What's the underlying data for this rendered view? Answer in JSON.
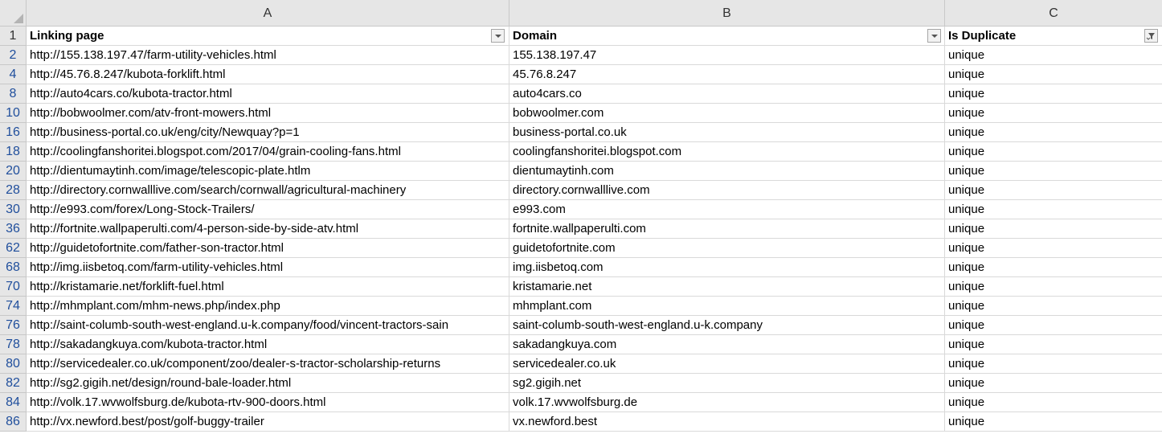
{
  "columns": [
    "A",
    "B",
    "C"
  ],
  "header_row_number": "1",
  "headers": {
    "linking_page": "Linking page",
    "domain": "Domain",
    "is_duplicate": "Is Duplicate"
  },
  "filter_icons": {
    "linking_page": "dropdown-arrow-icon",
    "domain": "dropdown-arrow-icon",
    "is_duplicate": "filter-funnel-icon"
  },
  "rows": [
    {
      "num": "2",
      "linking_page": "http://155.138.197.47/farm-utility-vehicles.html",
      "domain": "155.138.197.47",
      "is_duplicate": "unique"
    },
    {
      "num": "4",
      "linking_page": "http://45.76.8.247/kubota-forklift.html",
      "domain": "45.76.8.247",
      "is_duplicate": "unique"
    },
    {
      "num": "8",
      "linking_page": "http://auto4cars.co/kubota-tractor.html",
      "domain": "auto4cars.co",
      "is_duplicate": "unique"
    },
    {
      "num": "10",
      "linking_page": "http://bobwoolmer.com/atv-front-mowers.html",
      "domain": "bobwoolmer.com",
      "is_duplicate": "unique"
    },
    {
      "num": "16",
      "linking_page": "http://business-portal.co.uk/eng/city/Newquay?p=1",
      "domain": "business-portal.co.uk",
      "is_duplicate": "unique"
    },
    {
      "num": "18",
      "linking_page": "http://coolingfanshoritei.blogspot.com/2017/04/grain-cooling-fans.html",
      "domain": "coolingfanshoritei.blogspot.com",
      "is_duplicate": "unique"
    },
    {
      "num": "20",
      "linking_page": "http://dientumaytinh.com/image/telescopic-plate.htlm",
      "domain": "dientumaytinh.com",
      "is_duplicate": "unique"
    },
    {
      "num": "28",
      "linking_page": "http://directory.cornwalllive.com/search/cornwall/agricultural-machinery",
      "domain": "directory.cornwalllive.com",
      "is_duplicate": "unique"
    },
    {
      "num": "30",
      "linking_page": "http://e993.com/forex/Long-Stock-Trailers/",
      "domain": "e993.com",
      "is_duplicate": "unique"
    },
    {
      "num": "36",
      "linking_page": "http://fortnite.wallpaperulti.com/4-person-side-by-side-atv.html",
      "domain": "fortnite.wallpaperulti.com",
      "is_duplicate": "unique"
    },
    {
      "num": "62",
      "linking_page": "http://guidetofortnite.com/father-son-tractor.html",
      "domain": "guidetofortnite.com",
      "is_duplicate": "unique"
    },
    {
      "num": "68",
      "linking_page": "http://img.iisbetoq.com/farm-utility-vehicles.html",
      "domain": "img.iisbetoq.com",
      "is_duplicate": "unique"
    },
    {
      "num": "70",
      "linking_page": "http://kristamarie.net/forklift-fuel.html",
      "domain": "kristamarie.net",
      "is_duplicate": "unique"
    },
    {
      "num": "74",
      "linking_page": "http://mhmplant.com/mhm-news.php/index.php",
      "domain": "mhmplant.com",
      "is_duplicate": "unique"
    },
    {
      "num": "76",
      "linking_page": "http://saint-columb-south-west-england.u-k.company/food/vincent-tractors-sain",
      "domain": "saint-columb-south-west-england.u-k.company",
      "is_duplicate": "unique"
    },
    {
      "num": "78",
      "linking_page": "http://sakadangkuya.com/kubota-tractor.html",
      "domain": "sakadangkuya.com",
      "is_duplicate": "unique"
    },
    {
      "num": "80",
      "linking_page": "http://servicedealer.co.uk/component/zoo/dealer-s-tractor-scholarship-returns",
      "domain": "servicedealer.co.uk",
      "is_duplicate": "unique"
    },
    {
      "num": "82",
      "linking_page": "http://sg2.gigih.net/design/round-bale-loader.html",
      "domain": "sg2.gigih.net",
      "is_duplicate": "unique"
    },
    {
      "num": "84",
      "linking_page": "http://volk.17.wvwolfsburg.de/kubota-rtv-900-doors.html",
      "domain": "volk.17.wvwolfsburg.de",
      "is_duplicate": "unique"
    },
    {
      "num": "86",
      "linking_page": "http://vx.newford.best/post/golf-buggy-trailer",
      "domain": "vx.newford.best",
      "is_duplicate": "unique"
    }
  ]
}
